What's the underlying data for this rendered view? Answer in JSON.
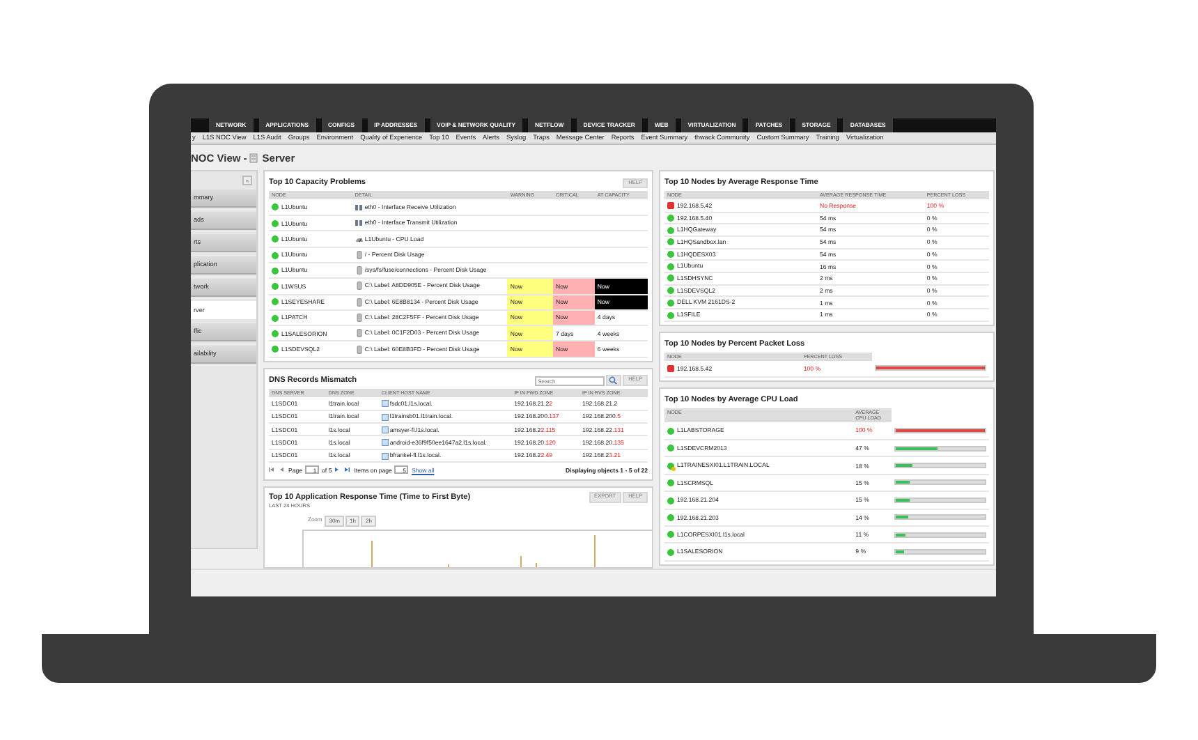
{
  "nav_tabs": [
    "NETWORK",
    "APPLICATIONS",
    "CONFIGS",
    "IP ADDRESSES",
    "VOIP & NETWORK QUALITY",
    "NETFLOW",
    "DEVICE TRACKER",
    "WEB",
    "VIRTUALIZATION",
    "PATCHES",
    "STORAGE",
    "DATABASES"
  ],
  "sub_nav": [
    "y",
    "L1S NOC View",
    "L1S Audit",
    "Groups",
    "Environment",
    "Quality of Experience",
    "Top 10",
    "Events",
    "Alerts",
    "Syslog",
    "Traps",
    "Message Center",
    "Reports",
    "Event Summary",
    "thwack Community",
    "Custom Summary",
    "Training",
    "Virtualization"
  ],
  "page_title": {
    "prefix": "NOC View -",
    "name": "Server"
  },
  "sidebar": {
    "collapse": "«",
    "items": [
      {
        "label": "mmary",
        "selected": false
      },
      {
        "label": "ads",
        "selected": false
      },
      {
        "label": "rts",
        "selected": false
      },
      {
        "label": "plication",
        "selected": false
      },
      {
        "label": "twork",
        "selected": false
      },
      {
        "label": "rver",
        "selected": true
      },
      {
        "label": "ffic",
        "selected": false
      },
      {
        "label": "ailability",
        "selected": false
      }
    ]
  },
  "capacity": {
    "title": "Top 10 Capacity Problems",
    "help": "HELP",
    "columns": [
      "NODE",
      "DETAIL",
      "WARNING",
      "CRITICAL",
      "AT CAPACITY"
    ],
    "rows": [
      {
        "node": "L1Ubuntu",
        "down": false,
        "kind": "interface",
        "detail": "eth0 - Interface Receive Utilization"
      },
      {
        "node": "L1Ubuntu",
        "down": false,
        "kind": "interface",
        "detail": "eth0 - Interface Transmit Utilization"
      },
      {
        "node": "L1Ubuntu",
        "down": false,
        "kind": "cpu",
        "detail": "L1Ubuntu - CPU Load"
      },
      {
        "node": "L1Ubuntu",
        "down": false,
        "kind": "disk",
        "detail": "/ - Percent Disk Usage"
      },
      {
        "node": "L1Ubuntu",
        "down": false,
        "kind": "disk",
        "detail": "/sys/fs/fuse/connections - Percent Disk Usage"
      },
      {
        "node": "L1WSUS",
        "down": false,
        "kind": "disk",
        "detail": "C:\\ Label: A8DD905E - Percent Disk Usage",
        "warning": {
          "text": "Now",
          "reached": true
        },
        "critical": {
          "text": "Now",
          "reached": true
        },
        "capacity": {
          "text": "Now",
          "reached": true
        }
      },
      {
        "node": "L1SEYESHARE",
        "down": false,
        "kind": "disk",
        "detail": "C:\\ Label: 6E8B8134 - Percent Disk Usage",
        "warning": {
          "text": "Now",
          "reached": true
        },
        "critical": {
          "text": "Now",
          "reached": true
        },
        "capacity": {
          "text": "Now",
          "reached": true
        }
      },
      {
        "node": "L1PATCH",
        "down": false,
        "kind": "disk",
        "detail": "C:\\ Label: 28C2F5FF - Percent Disk Usage",
        "warning": {
          "text": "Now",
          "reached": true
        },
        "critical": {
          "text": "Now",
          "reached": true
        },
        "capacity": {
          "text": "4 days",
          "reached": false
        }
      },
      {
        "node": "L1SALESORION",
        "down": false,
        "kind": "disk",
        "detail": "C:\\ Label: 0C1F2D03 - Percent Disk Usage",
        "warning": {
          "text": "Now",
          "reached": true
        },
        "critical": {
          "text": "7 days",
          "reached": false
        },
        "capacity": {
          "text": "4 weeks",
          "reached": false
        }
      },
      {
        "node": "L1SDEVSQL2",
        "down": false,
        "kind": "disk",
        "detail": "C:\\ Label: 60E8B3FD - Percent Disk Usage",
        "warning": {
          "text": "Now",
          "reached": true
        },
        "critical": {
          "text": "Now",
          "reached": true
        },
        "capacity": {
          "text": "6 weeks",
          "reached": false
        }
      }
    ]
  },
  "dns": {
    "title": "DNS Records Mismatch",
    "search": {
      "placeholder": "Search"
    },
    "help": "HELP",
    "columns": [
      "DNS SERVER",
      "DNS ZONE",
      "CLIENT HOST NAME",
      "IP IN FWD ZONE",
      "IP IN RVS ZONE"
    ],
    "rows": [
      {
        "server": "L1SDC01",
        "zone": "l1train.local",
        "host": "fsdc01.l1s.local.",
        "fwd": "192.168.21.2",
        "fwd_diff": "2",
        "rvs": "192.168.21.2"
      },
      {
        "server": "L1SDC01",
        "zone": "l1train.local",
        "host": "l1trainsb01.l1train.local.",
        "fwd": "192.168.200.",
        "fwd_diff": "137",
        "rvs": "192.168.200.",
        "rvs_diff": "5"
      },
      {
        "server": "L1SDC01",
        "zone": "l1s.local",
        "host": "amsyer-fl.l1s.local.",
        "fwd": "192.168.2",
        "fwd_diff": "2.115",
        "rvs": "192.168.22.",
        "rvs_diff": "131"
      },
      {
        "server": "L1SDC01",
        "zone": "l1s.local",
        "host": "android-e36f9f50ee1647a2.l1s.local.",
        "fwd": "192.168.20.",
        "fwd_diff": "120",
        "rvs": "192.168.20.",
        "rvs_diff": "135"
      },
      {
        "server": "L1SDC01",
        "zone": "l1s.local",
        "host": "bfrankel-fl.l1s.local.",
        "fwd": "192.168.2",
        "fwd_diff": "2.49",
        "rvs": "192.168.2",
        "rvs_diff": "3.21"
      }
    ],
    "pager": {
      "page_label": "Page",
      "page": "1",
      "of": "of 5",
      "items_label": "Items on page",
      "items": "5",
      "show_all": "Show all",
      "summary": "Displaying objects 1 - 5 of 22"
    }
  },
  "app_response": {
    "title": "Top 10 Application Response Time (Time to First Byte)",
    "subtitle": "LAST 24 HOURS",
    "buttons": [
      "EXPORT",
      "HELP"
    ],
    "zoom_label": "Zoom",
    "zoom_buttons": [
      "30m",
      "1h",
      "2h"
    ]
  },
  "response_time": {
    "title": "Top 10 Nodes by Average Response Time",
    "columns": [
      "NODE",
      "AVERAGE RESPONSE TIME",
      "PERCENT LOSS"
    ],
    "rows": [
      {
        "node": "192.168.5.42",
        "down": true,
        "time": "No Response",
        "loss": "100 %",
        "critical": true
      },
      {
        "node": "192.168.5.40",
        "down": false,
        "time": "54 ms",
        "loss": "0 %",
        "critical": false
      },
      {
        "node": "L1HQGateway",
        "down": false,
        "time": "54 ms",
        "loss": "0 %",
        "critical": false
      },
      {
        "node": "L1HQSandbox.lan",
        "down": false,
        "time": "54 ms",
        "loss": "0 %",
        "critical": false
      },
      {
        "node": "L1HQDESX03",
        "down": false,
        "time": "54 ms",
        "loss": "0 %",
        "critical": false
      },
      {
        "node": "L1Ubuntu",
        "down": false,
        "time": "16 ms",
        "loss": "0 %",
        "critical": false
      },
      {
        "node": "L1SDHSYNC",
        "down": false,
        "time": "2 ms",
        "loss": "0 %",
        "critical": false
      },
      {
        "node": "L1SDEVSQL2",
        "down": false,
        "time": "2 ms",
        "loss": "0 %",
        "critical": false
      },
      {
        "node": "DELL KVM 2161DS-2",
        "down": false,
        "time": "1 ms",
        "loss": "0 %",
        "critical": false
      },
      {
        "node": "L1SFILE",
        "down": false,
        "time": "1 ms",
        "loss": "0 %",
        "critical": false
      }
    ]
  },
  "packet_loss": {
    "title": "Top 10 Nodes by Percent Packet Loss",
    "columns": [
      "NODE",
      "PERCENT LOSS"
    ],
    "rows": [
      {
        "node": "192.168.5.42",
        "down": true,
        "value": "100 %",
        "level": 1,
        "critical": true
      }
    ]
  },
  "cpu_load": {
    "title": "Top 10 Nodes by Average CPU Load",
    "columns": [
      "NODE",
      "AVERAGE CPU LOAD"
    ],
    "rows": [
      {
        "node": "L1LABSTORAGE",
        "down": false,
        "alert": false,
        "value": "100 %",
        "level": 1,
        "critical": true
      },
      {
        "node": "L1SDEVCRM2013",
        "down": false,
        "alert": false,
        "value": "47 %",
        "level": 0.47,
        "critical": false
      },
      {
        "node": "L1TRAINESXI01.L1TRAIN.LOCAL",
        "down": false,
        "alert": true,
        "value": "18 %",
        "level": 0.18,
        "critical": false
      },
      {
        "node": "L1SCRMSQL",
        "down": false,
        "alert": false,
        "value": "15 %",
        "level": 0.15,
        "critical": false
      },
      {
        "node": "192.168.21.204",
        "down": false,
        "alert": false,
        "value": "15 %",
        "level": 0.15,
        "critical": false
      },
      {
        "node": "192.168.21.203",
        "down": false,
        "alert": false,
        "value": "14 %",
        "level": 0.14,
        "critical": false
      },
      {
        "node": "L1CORPESXI01.l1s.local",
        "down": false,
        "alert": false,
        "value": "11 %",
        "level": 0.11,
        "critical": false
      },
      {
        "node": "L1SALESORION",
        "down": false,
        "alert": false,
        "value": "9 %",
        "level": 0.09,
        "critical": false
      }
    ]
  }
}
